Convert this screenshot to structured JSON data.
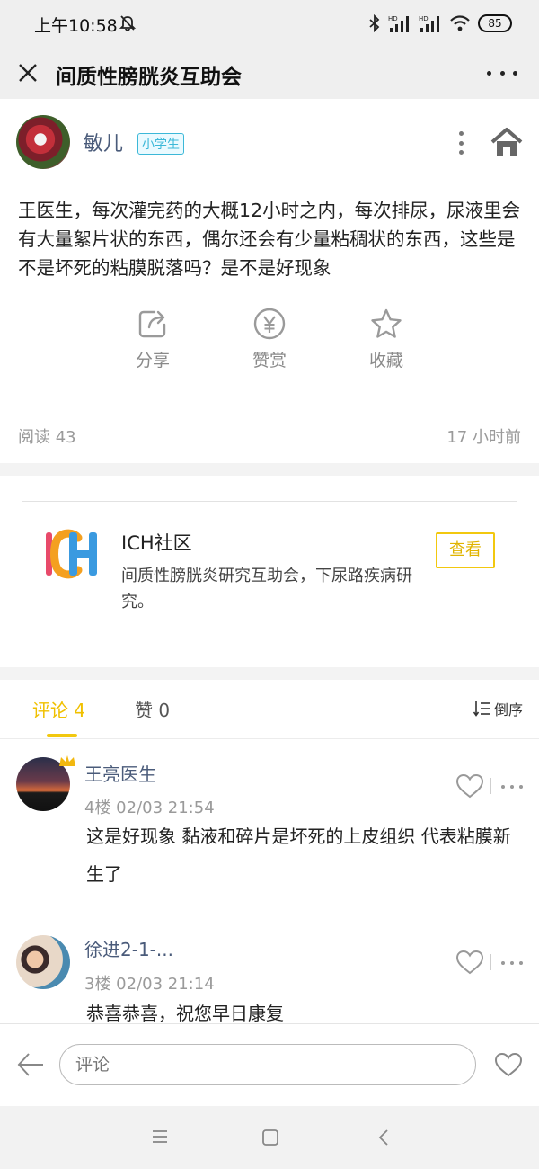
{
  "status_bar": {
    "time": "上午10:58",
    "battery": "85",
    "hd1": "HD",
    "hd2": "HD"
  },
  "header": {
    "title": "间质性膀胱炎互助会"
  },
  "post": {
    "author": "敏儿",
    "badge": "小学生",
    "text": "王医生，每次灌完药的大概12小时之内，每次排尿，尿液里会有大量絮片状的东西，偶尔还会有少量粘稠状的东西，这些是不是坏死的粘膜脱落吗？是不是好现象",
    "actions": {
      "share": "分享",
      "reward": "赞赏",
      "favorite": "收藏"
    },
    "read_count": "阅读 43",
    "time_ago": "17 小时前"
  },
  "community": {
    "name": "ICH社区",
    "description": "间质性膀胱炎研究互助会，下尿路疾病研究。",
    "view_button": "查看"
  },
  "tabs": {
    "comments": "评论 4",
    "likes": "赞 0",
    "sort": "倒序"
  },
  "comments": [
    {
      "name": "王亮医生",
      "meta": "4楼   02/03 21:54",
      "text": "这是好现象 黏液和碎片是坏死的上皮组织 代表粘膜新生了"
    },
    {
      "name": "徐进2-1-...",
      "meta": "3楼   02/03 21:14",
      "text": "恭喜恭喜，祝您早日康复"
    }
  ],
  "comment_bar": {
    "placeholder": "评论"
  },
  "colors": {
    "accent": "#f2c80f",
    "name_blue": "#4a5b7a",
    "badge_blue": "#3cb8d8"
  }
}
